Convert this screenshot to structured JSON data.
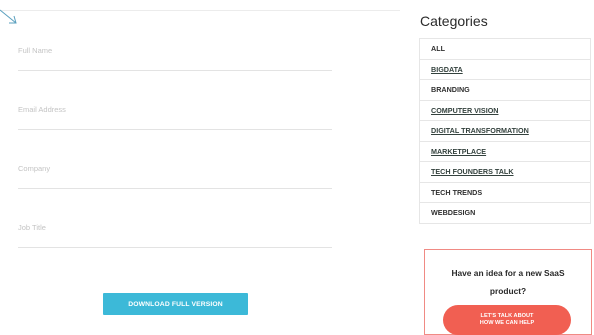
{
  "form": {
    "fields": [
      {
        "placeholder": "Full Name"
      },
      {
        "placeholder": "Email Address"
      },
      {
        "placeholder": "Company"
      },
      {
        "placeholder": "Job Title"
      }
    ],
    "download_label": "DOWNLOAD FULL VERSION"
  },
  "sidebar": {
    "title": "Categories",
    "categories": [
      {
        "label": "ALL"
      },
      {
        "label": "BIGDATA"
      },
      {
        "label": "BRANDING"
      },
      {
        "label": "COMPUTER VISION"
      },
      {
        "label": "DIGITAL TRANSFORMATION"
      },
      {
        "label": "MARKETPLACE"
      },
      {
        "label": "TECH FOUNDERS TALK"
      },
      {
        "label": "TECH TRENDS"
      },
      {
        "label": "WEBDESIGN"
      }
    ]
  },
  "cta": {
    "text_line1": "Have an idea for a new SaaS",
    "text_line2": "product?",
    "button_line1": "LET'S TALK ABOUT",
    "button_line2": "HOW WE CAN HELP"
  },
  "colors": {
    "download_button": "#3cb9d8",
    "cta_button": "#f15f52",
    "cta_border": "#f08a84"
  },
  "icons": {
    "decor_arrow": "arrow-icon"
  }
}
